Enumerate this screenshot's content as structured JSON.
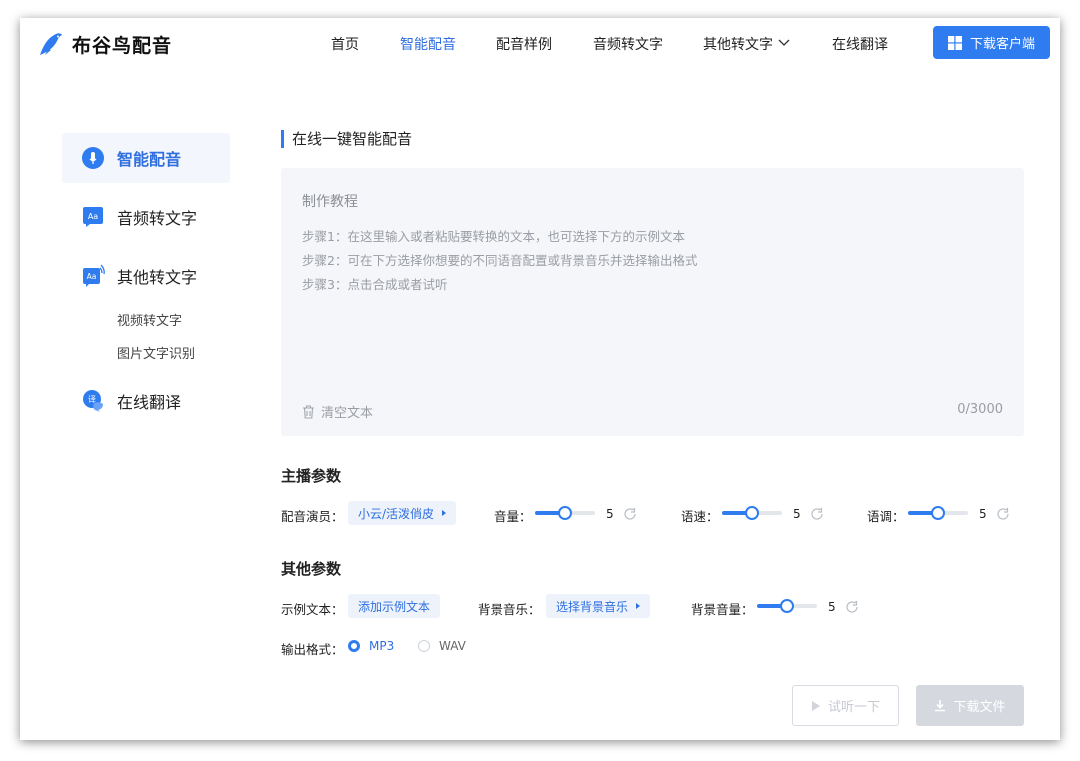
{
  "app": {
    "name": "布谷鸟配音"
  },
  "nav": {
    "items": [
      "首页",
      "智能配音",
      "配音样例",
      "音频转文字",
      "其他转文字",
      "在线翻译"
    ],
    "active": "智能配音",
    "download_client": "下载客户端"
  },
  "sidebar": {
    "items": [
      {
        "label": "智能配音",
        "icon": "mic-bubble-icon",
        "active": true
      },
      {
        "label": "音频转文字",
        "icon": "aa-bubble-icon"
      },
      {
        "label": "其他转文字",
        "icon": "aa-wave-bubble-icon"
      },
      {
        "label": "在线翻译",
        "icon": "translate-bubble-icon"
      }
    ],
    "sub_items": [
      "视频转文字",
      "图片文字识别"
    ]
  },
  "main": {
    "section_title": "在线一键智能配音",
    "editor": {
      "heading": "制作教程",
      "steps": [
        "步骤1：在这里输入或者粘贴要转换的文本，也可选择下方的示例文本",
        "步骤2：可在下方选择你想要的不同语音配置或背景音乐并选择输出格式",
        "步骤3：点击合成或者试听"
      ],
      "clear_label": "清空文本",
      "counter": "0/3000"
    },
    "anchor": {
      "title": "主播参数",
      "voice_label": "配音演员：",
      "voice_value": "小云/活泼俏皮",
      "volume_label": "音量：",
      "volume_value": "5",
      "speed_label": "语速：",
      "speed_value": "5",
      "pitch_label": "语调：",
      "pitch_value": "5",
      "slider_max": 10
    },
    "other": {
      "title": "其他参数",
      "sample_label": "示例文本：",
      "sample_button": "添加示例文本",
      "bgm_label": "背景音乐：",
      "bgm_button": "选择背景音乐",
      "bgm_volume_label": "背景音量：",
      "bgm_volume_value": "5",
      "format_label": "输出格式：",
      "formats": [
        "MP3",
        "WAV"
      ],
      "format_selected": "MP3"
    },
    "actions": {
      "try_listen": "试听一下",
      "download_file": "下载文件"
    }
  },
  "colors": {
    "accent": "#2f7cf0",
    "active_text": "#2f6fe0",
    "disabled": "#d5d9df"
  }
}
